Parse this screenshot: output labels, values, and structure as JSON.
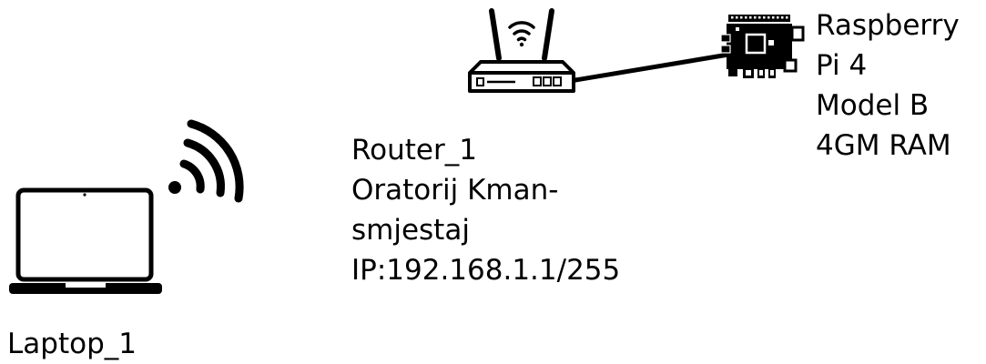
{
  "diagram": {
    "laptop": {
      "label": "Laptop_1",
      "icon": "laptop-icon"
    },
    "wifi": {
      "icon": "wifi-signal-icon"
    },
    "router": {
      "icon": "router-icon",
      "lines": [
        "Router_1",
        "Oratorij Kman-",
        "smjestaj",
        "IP:192.168.1.1/255"
      ]
    },
    "raspberry_pi": {
      "icon": "raspberry-pi-board-icon",
      "lines": [
        "Raspberry",
        "Pi 4",
        "Model B",
        "4GM RAM"
      ]
    },
    "connection": {
      "type": "ethernet-cable",
      "from": "Router_1",
      "to": "Raspberry Pi 4",
      "color": "#000000"
    }
  }
}
